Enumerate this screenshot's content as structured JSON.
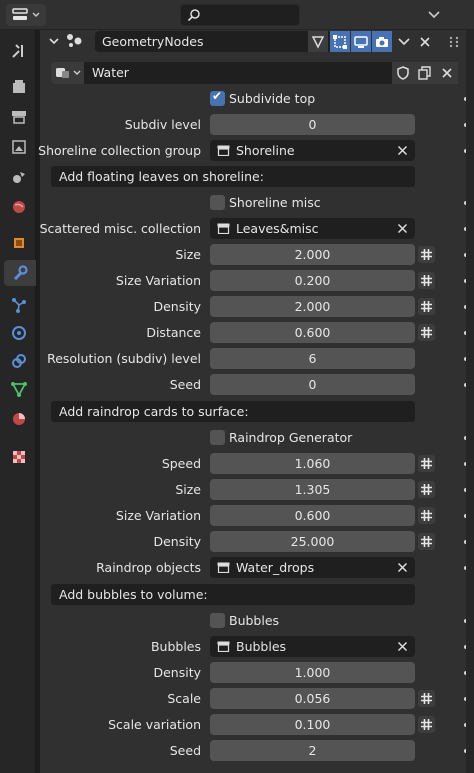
{
  "header": {
    "editor_type_icon": "properties-editor-icon",
    "search_icon": "search-icon"
  },
  "modifier": {
    "name": "GeometryNodes",
    "node_group": "Water"
  },
  "subdivide_top": {
    "label": "Subdivide top",
    "checked": true
  },
  "subdiv_level": {
    "label": "Subdiv level",
    "value": "0"
  },
  "shoreline_collection": {
    "label": "Shoreline collection group",
    "value": "Shoreline"
  },
  "section_floating": "Add floating leaves on shoreline:",
  "shoreline_misc": {
    "label": "Shoreline misc",
    "checked": false
  },
  "scattered_collection": {
    "label": "Scattered misc. collection",
    "value": "Leaves&misc"
  },
  "floating": {
    "size": {
      "label": "Size",
      "value": "2.000"
    },
    "size_variation": {
      "label": "Size Variation",
      "value": "0.200"
    },
    "density": {
      "label": "Density",
      "value": "2.000"
    },
    "distance": {
      "label": "Distance",
      "value": "0.600"
    },
    "resolution": {
      "label": "Resolution (subdiv) level",
      "value": "6"
    },
    "seed": {
      "label": "Seed",
      "value": "0"
    }
  },
  "section_raindrop": "Add raindrop cards to surface:",
  "raindrop_generator": {
    "label": "Raindrop Generator",
    "checked": false
  },
  "raindrop": {
    "speed": {
      "label": "Speed",
      "value": "1.060"
    },
    "size": {
      "label": "Size",
      "value": "1.305"
    },
    "size_variation": {
      "label": "Size Variation",
      "value": "0.600"
    },
    "density": {
      "label": "Density",
      "value": "25.000"
    },
    "objects": {
      "label": "Raindrop objects",
      "value": "Water_drops"
    }
  },
  "section_bubbles": "Add bubbles to volume:",
  "bubbles_toggle": {
    "label": "Bubbles",
    "checked": false
  },
  "bubbles": {
    "collection": {
      "label": "Bubbles",
      "value": "Bubbles"
    },
    "density": {
      "label": "Density",
      "value": "1.000"
    },
    "scale": {
      "label": "Scale",
      "value": "0.056"
    },
    "scale_variation": {
      "label": "Scale variation",
      "value": "0.100"
    },
    "seed": {
      "label": "Seed",
      "value": "2"
    }
  },
  "colors": {
    "accent": "#4772b3",
    "panel": "#303030",
    "field": "#545454"
  }
}
